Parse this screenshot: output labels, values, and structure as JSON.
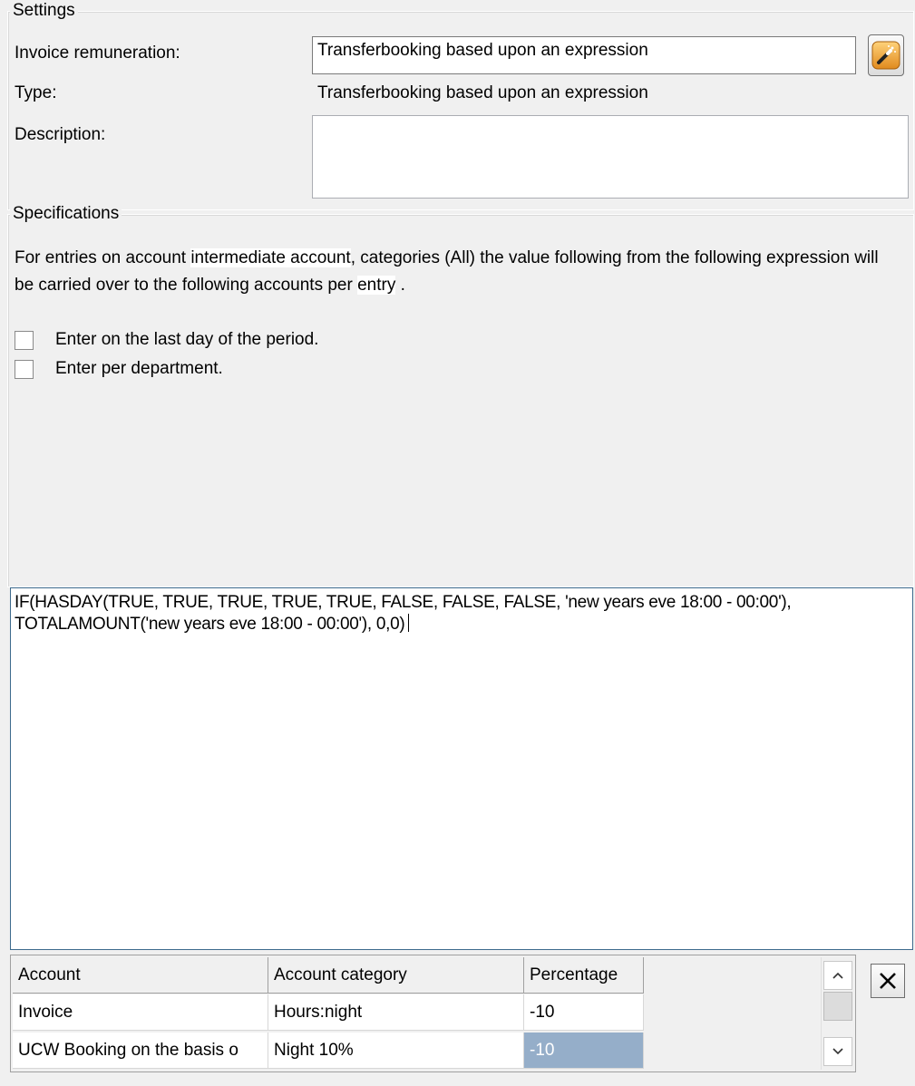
{
  "settings": {
    "title": "Settings",
    "invoice_remuneration_label": "Invoice remuneration:",
    "invoice_remuneration_value": "Transferbooking based upon an expression",
    "type_label": "Type:",
    "type_value": "Transferbooking based upon an expression",
    "description_label": "Description:",
    "description_value": ""
  },
  "specifications": {
    "title": "Specifications",
    "text_part1": "For entries on account ",
    "text_account": "intermediate account",
    "text_part2": ", categories (All) the value following from the following expression will be carried over to the following accounts per ",
    "text_per": "entry",
    "text_part3": " .",
    "checkbox_last_day": "Enter on the last day of the period.",
    "checkbox_per_department": "Enter per department."
  },
  "expression": {
    "value": "IF(HASDAY(TRUE, TRUE, TRUE, TRUE, TRUE, FALSE, FALSE, FALSE, 'new years eve 18:00 - 00:00'), TOTALAMOUNT('new years eve 18:00 - 00:00'), 0,0)"
  },
  "grid": {
    "headers": [
      "Account",
      "Account category",
      "Percentage"
    ],
    "rows": [
      [
        "Invoice",
        "Hours:night",
        "-10"
      ],
      [
        "UCW Booking on the basis o",
        "Night 10%",
        "-10"
      ]
    ],
    "selected_cell": "row 2, Percentage"
  },
  "icons": {
    "wizard": "magic-wand-icon",
    "delete": "close-x-icon",
    "scroll_up": "chevron-up-icon",
    "scroll_down": "chevron-down-icon"
  },
  "colors": {
    "background": "#f0f0f0",
    "selection": "#95aec9",
    "expression_border": "#3c6a8c"
  }
}
